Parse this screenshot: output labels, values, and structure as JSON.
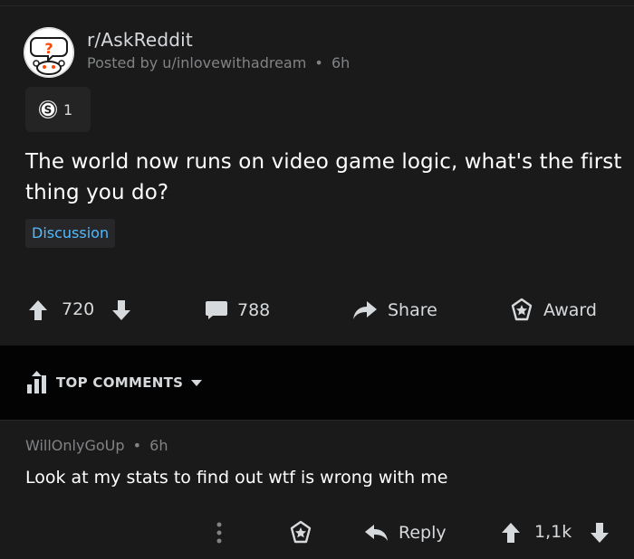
{
  "post": {
    "subreddit": "r/AskReddit",
    "posted_by_prefix": "Posted by",
    "author": "u/inlovewithadream",
    "separator": "•",
    "age": "6h",
    "awards": {
      "icon": "silver-award-icon",
      "count": "1"
    },
    "title": "The world now runs on video game logic, what's the first thing you do?",
    "flair": "Discussion",
    "actions": {
      "upvote_icon": "upvote-arrow-icon",
      "score": "720",
      "downvote_icon": "downvote-arrow-icon",
      "comment_icon": "comment-bubble-icon",
      "comments_count": "788",
      "share_icon": "share-arrow-icon",
      "share_label": "Share",
      "award_icon": "award-star-icon",
      "award_label": "Award"
    }
  },
  "sort": {
    "icon": "top-sort-icon",
    "label": "TOP COMMENTS",
    "chevron_icon": "caret-down-icon"
  },
  "comment": {
    "author": "WillOnlyGoUp",
    "separator": "•",
    "age": "6h",
    "body": "Look at my stats to find out wtf is wrong with me",
    "actions": {
      "more_icon": "vertical-dots-icon",
      "award_icon": "award-star-icon",
      "reply_icon": "reply-arrow-icon",
      "reply_label": "Reply",
      "upvote_icon": "upvote-arrow-icon",
      "score": "1,1k",
      "downvote_icon": "downvote-arrow-icon"
    }
  },
  "colors": {
    "background": "#1a1a1b",
    "sort_bar": "#030303",
    "text": "#d7dadc",
    "meta": "#818384",
    "flair": "#4fbcff",
    "title": "#ffffff"
  }
}
